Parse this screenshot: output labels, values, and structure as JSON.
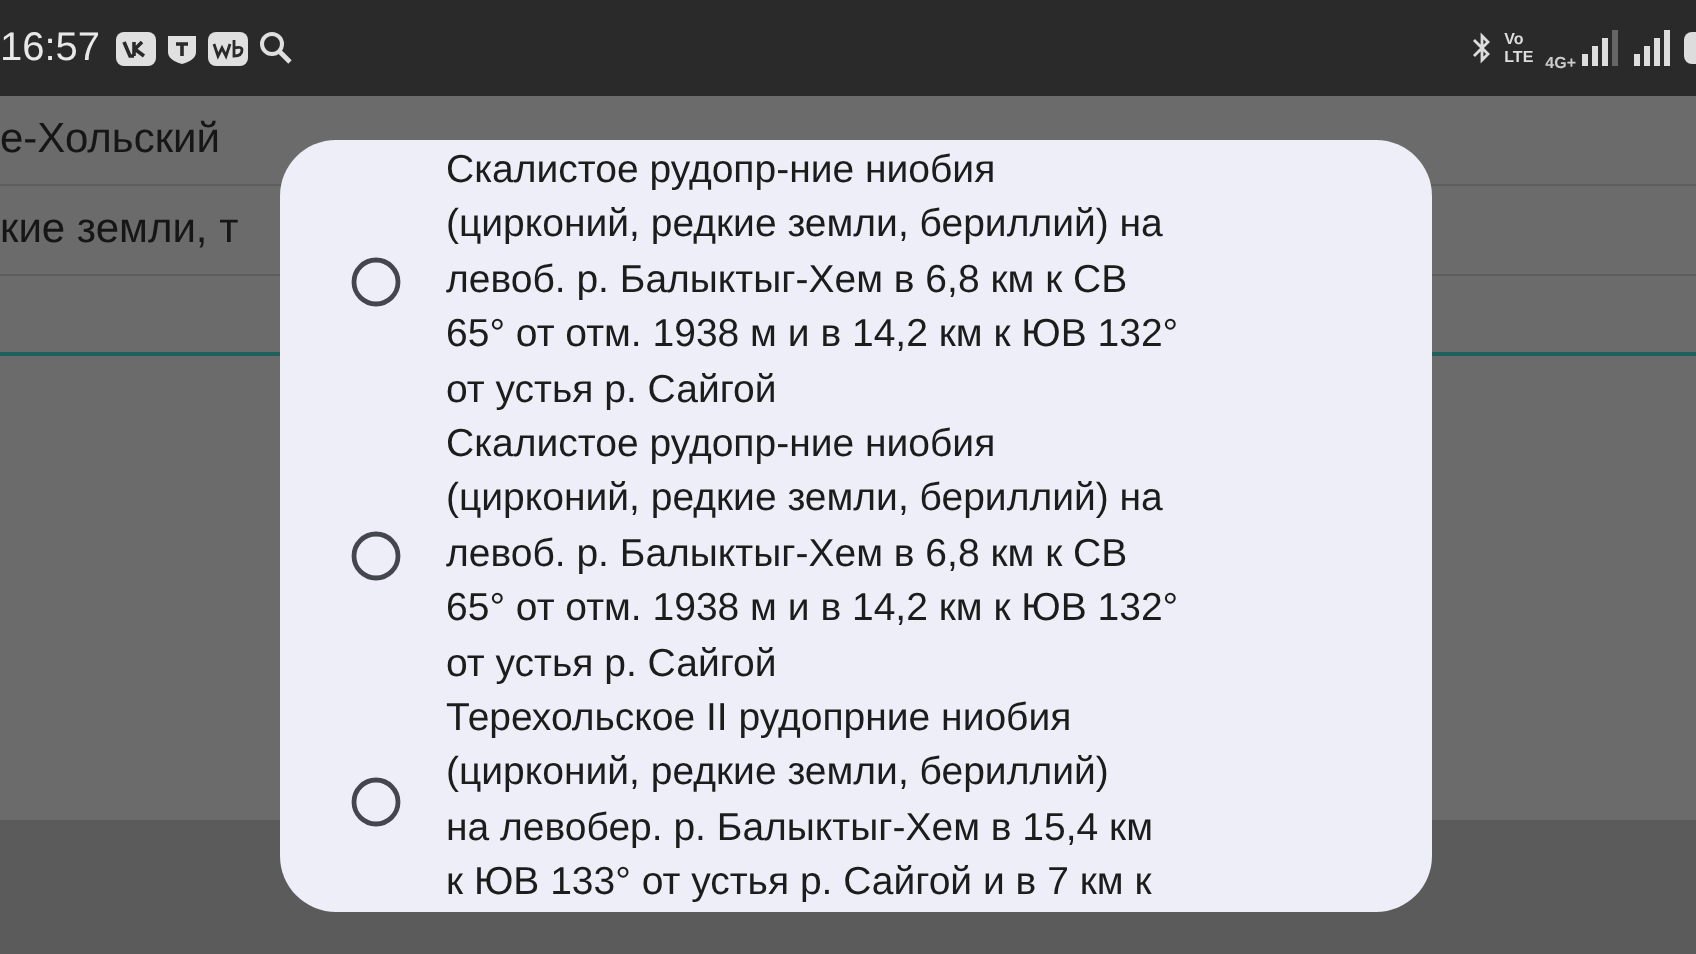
{
  "status_bar": {
    "time": "16:57",
    "volte_top": "Vo",
    "volte_bottom": "LTE",
    "network": "4G+"
  },
  "background": {
    "rows": [
      "е-Хольский",
      "кие земли, т"
    ]
  },
  "dialog": {
    "options": [
      {
        "text": "Скалистое рудопр-ние ниобия\n(цирконий, редкие земли, бериллий) на\nлевоб. р. Балыктыг-Хем в 6,8 км к СВ\n65° от отм. 1938 м и в 14,2 км к ЮВ 132°\nот устья р. Сайгой",
        "selected": false
      },
      {
        "text": "Скалистое рудопр-ние ниобия\n(цирконий, редкие земли, бериллий) на\nлевоб. р. Балыктыг-Хем в 6,8 км к СВ\n65° от отм. 1938 м и в 14,2 км к ЮВ 132°\nот устья р. Сайгой",
        "selected": false
      },
      {
        "text": "Терехольское II рудопрние ниобия\n(цирконий, редкие земли, бериллий)\nна левобер. р. Балыктыг-Хем в 15,4 км\nк ЮВ 133° от устья р. Сайгой и в 7 км к",
        "selected": false
      }
    ]
  }
}
